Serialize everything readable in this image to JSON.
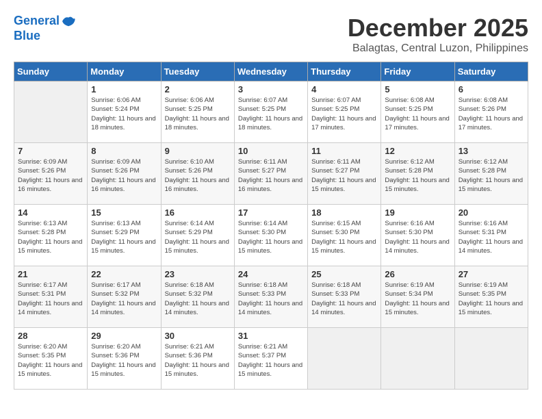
{
  "header": {
    "logo_line1": "General",
    "logo_line2": "Blue",
    "month_title": "December 2025",
    "location": "Balagtas, Central Luzon, Philippines"
  },
  "weekdays": [
    "Sunday",
    "Monday",
    "Tuesday",
    "Wednesday",
    "Thursday",
    "Friday",
    "Saturday"
  ],
  "weeks": [
    [
      {
        "day": "",
        "sunrise": "",
        "sunset": "",
        "daylight": ""
      },
      {
        "day": "1",
        "sunrise": "6:06 AM",
        "sunset": "5:24 PM",
        "daylight": "11 hours and 18 minutes."
      },
      {
        "day": "2",
        "sunrise": "6:06 AM",
        "sunset": "5:25 PM",
        "daylight": "11 hours and 18 minutes."
      },
      {
        "day": "3",
        "sunrise": "6:07 AM",
        "sunset": "5:25 PM",
        "daylight": "11 hours and 18 minutes."
      },
      {
        "day": "4",
        "sunrise": "6:07 AM",
        "sunset": "5:25 PM",
        "daylight": "11 hours and 17 minutes."
      },
      {
        "day": "5",
        "sunrise": "6:08 AM",
        "sunset": "5:25 PM",
        "daylight": "11 hours and 17 minutes."
      },
      {
        "day": "6",
        "sunrise": "6:08 AM",
        "sunset": "5:26 PM",
        "daylight": "11 hours and 17 minutes."
      }
    ],
    [
      {
        "day": "7",
        "sunrise": "6:09 AM",
        "sunset": "5:26 PM",
        "daylight": "11 hours and 16 minutes."
      },
      {
        "day": "8",
        "sunrise": "6:09 AM",
        "sunset": "5:26 PM",
        "daylight": "11 hours and 16 minutes."
      },
      {
        "day": "9",
        "sunrise": "6:10 AM",
        "sunset": "5:26 PM",
        "daylight": "11 hours and 16 minutes."
      },
      {
        "day": "10",
        "sunrise": "6:11 AM",
        "sunset": "5:27 PM",
        "daylight": "11 hours and 16 minutes."
      },
      {
        "day": "11",
        "sunrise": "6:11 AM",
        "sunset": "5:27 PM",
        "daylight": "11 hours and 15 minutes."
      },
      {
        "day": "12",
        "sunrise": "6:12 AM",
        "sunset": "5:28 PM",
        "daylight": "11 hours and 15 minutes."
      },
      {
        "day": "13",
        "sunrise": "6:12 AM",
        "sunset": "5:28 PM",
        "daylight": "11 hours and 15 minutes."
      }
    ],
    [
      {
        "day": "14",
        "sunrise": "6:13 AM",
        "sunset": "5:28 PM",
        "daylight": "11 hours and 15 minutes."
      },
      {
        "day": "15",
        "sunrise": "6:13 AM",
        "sunset": "5:29 PM",
        "daylight": "11 hours and 15 minutes."
      },
      {
        "day": "16",
        "sunrise": "6:14 AM",
        "sunset": "5:29 PM",
        "daylight": "11 hours and 15 minutes."
      },
      {
        "day": "17",
        "sunrise": "6:14 AM",
        "sunset": "5:30 PM",
        "daylight": "11 hours and 15 minutes."
      },
      {
        "day": "18",
        "sunrise": "6:15 AM",
        "sunset": "5:30 PM",
        "daylight": "11 hours and 15 minutes."
      },
      {
        "day": "19",
        "sunrise": "6:16 AM",
        "sunset": "5:30 PM",
        "daylight": "11 hours and 14 minutes."
      },
      {
        "day": "20",
        "sunrise": "6:16 AM",
        "sunset": "5:31 PM",
        "daylight": "11 hours and 14 minutes."
      }
    ],
    [
      {
        "day": "21",
        "sunrise": "6:17 AM",
        "sunset": "5:31 PM",
        "daylight": "11 hours and 14 minutes."
      },
      {
        "day": "22",
        "sunrise": "6:17 AM",
        "sunset": "5:32 PM",
        "daylight": "11 hours and 14 minutes."
      },
      {
        "day": "23",
        "sunrise": "6:18 AM",
        "sunset": "5:32 PM",
        "daylight": "11 hours and 14 minutes."
      },
      {
        "day": "24",
        "sunrise": "6:18 AM",
        "sunset": "5:33 PM",
        "daylight": "11 hours and 14 minutes."
      },
      {
        "day": "25",
        "sunrise": "6:18 AM",
        "sunset": "5:33 PM",
        "daylight": "11 hours and 14 minutes."
      },
      {
        "day": "26",
        "sunrise": "6:19 AM",
        "sunset": "5:34 PM",
        "daylight": "11 hours and 15 minutes."
      },
      {
        "day": "27",
        "sunrise": "6:19 AM",
        "sunset": "5:35 PM",
        "daylight": "11 hours and 15 minutes."
      }
    ],
    [
      {
        "day": "28",
        "sunrise": "6:20 AM",
        "sunset": "5:35 PM",
        "daylight": "11 hours and 15 minutes."
      },
      {
        "day": "29",
        "sunrise": "6:20 AM",
        "sunset": "5:36 PM",
        "daylight": "11 hours and 15 minutes."
      },
      {
        "day": "30",
        "sunrise": "6:21 AM",
        "sunset": "5:36 PM",
        "daylight": "11 hours and 15 minutes."
      },
      {
        "day": "31",
        "sunrise": "6:21 AM",
        "sunset": "5:37 PM",
        "daylight": "11 hours and 15 minutes."
      },
      {
        "day": "",
        "sunrise": "",
        "sunset": "",
        "daylight": ""
      },
      {
        "day": "",
        "sunrise": "",
        "sunset": "",
        "daylight": ""
      },
      {
        "day": "",
        "sunrise": "",
        "sunset": "",
        "daylight": ""
      }
    ]
  ],
  "labels": {
    "sunrise_prefix": "Sunrise: ",
    "sunset_prefix": "Sunset: ",
    "daylight_prefix": "Daylight: "
  }
}
